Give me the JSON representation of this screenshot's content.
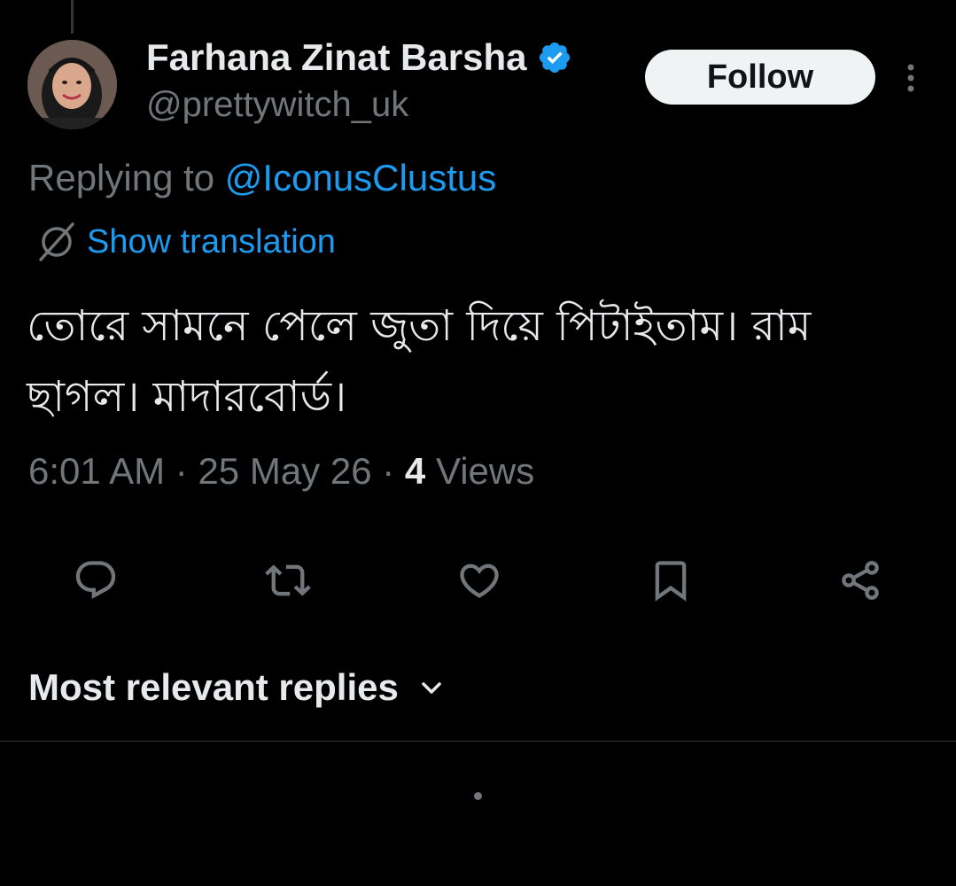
{
  "tweet": {
    "author": {
      "display_name": "Farhana Zinat Barsha",
      "handle": "@prettywitch_uk",
      "verified": true
    },
    "follow_label": "Follow",
    "replying_prefix": "Replying to",
    "replying_to": "@IconusClustus",
    "translation_label": "Show translation",
    "text_line1": "তোরে সামনে পেলে জুতা দিয়ে পিটাইতাম। রাম",
    "text_line2": "ছাগল। মাদারবোর্ড।",
    "time": "6:01 AM",
    "date": "25 May 26",
    "separator": "·",
    "views_count": "4",
    "views_label": "Views"
  },
  "actions": [
    {
      "name": "reply",
      "icon": "reply-icon"
    },
    {
      "name": "retweet",
      "icon": "retweet-icon"
    },
    {
      "name": "like",
      "icon": "heart-icon"
    },
    {
      "name": "bookmark",
      "icon": "bookmark-icon"
    },
    {
      "name": "share",
      "icon": "share-icon"
    }
  ],
  "replies": {
    "sort_label": "Most relevant replies"
  },
  "colors": {
    "background": "#000000",
    "accent": "#1d9bf0",
    "primary_text": "#e7e9ea",
    "secondary_text": "#71767b",
    "follow_button_bg": "#eff3f4"
  }
}
